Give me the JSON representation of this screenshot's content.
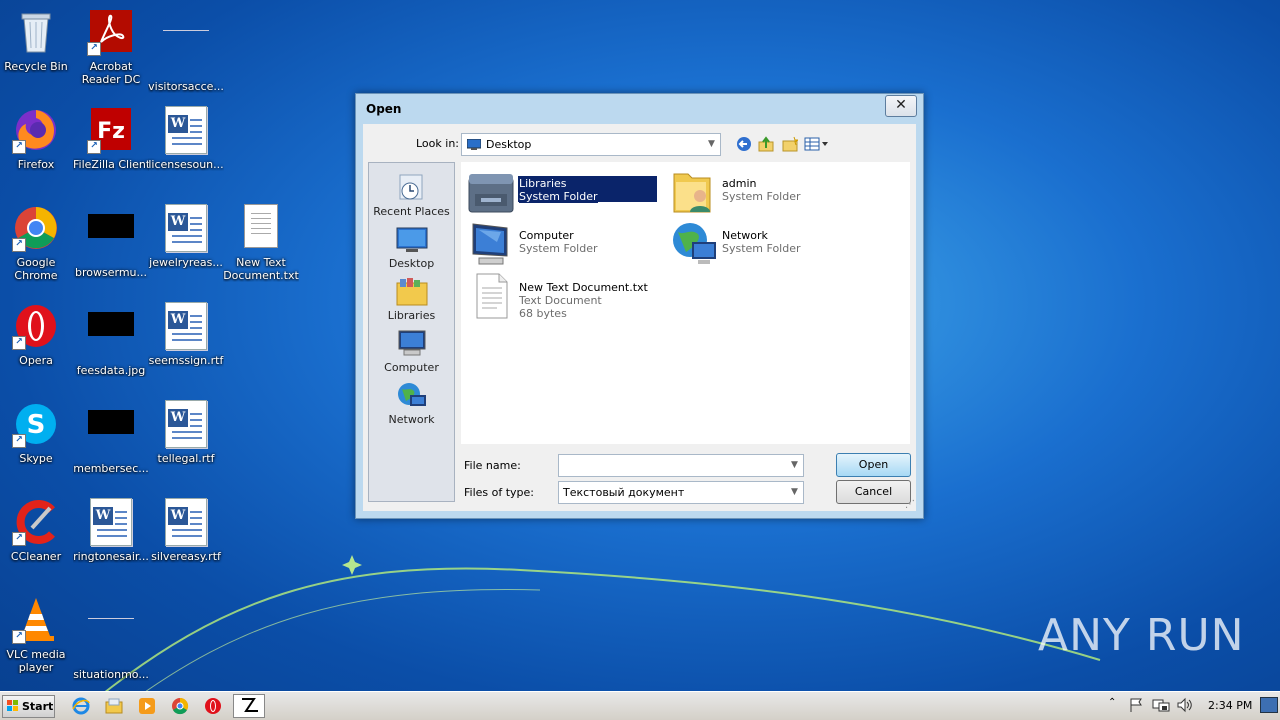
{
  "desktop": {
    "icons": [
      {
        "label": "Recycle Bin"
      },
      {
        "label": "Acrobat Reader DC"
      },
      {
        "label": "visitorsacce..."
      },
      {
        "label": "Firefox"
      },
      {
        "label": "FileZilla Client"
      },
      {
        "label": "licensesoun..."
      },
      {
        "label": "Google Chrome"
      },
      {
        "label": "browsermu..."
      },
      {
        "label": "jewelryreas..."
      },
      {
        "label": "New Text Document.txt"
      },
      {
        "label": "Opera"
      },
      {
        "label": "feesdata.jpg"
      },
      {
        "label": "seemssign.rtf"
      },
      {
        "label": "Skype"
      },
      {
        "label": "membersec..."
      },
      {
        "label": "tellegal.rtf"
      },
      {
        "label": "CCleaner"
      },
      {
        "label": "ringtonesair..."
      },
      {
        "label": "silvereasy.rtf"
      },
      {
        "label": "VLC media player"
      },
      {
        "label": "situationmo..."
      }
    ]
  },
  "dialog": {
    "title": "Open",
    "close_label": "✕",
    "look_in_label": "Look in:",
    "look_in_value": "Desktop",
    "places": [
      {
        "label": "Recent Places",
        "icon": "recent-places-icon"
      },
      {
        "label": "Desktop",
        "icon": "desktop-icon"
      },
      {
        "label": "Libraries",
        "icon": "libraries-icon"
      },
      {
        "label": "Computer",
        "icon": "computer-icon"
      },
      {
        "label": "Network",
        "icon": "network-icon"
      }
    ],
    "files": [
      {
        "name": "Libraries",
        "type": "System Folder",
        "selected": true
      },
      {
        "name": "admin",
        "type": "System Folder"
      },
      {
        "name": "Computer",
        "type": "System Folder"
      },
      {
        "name": "Network",
        "type": "System Folder"
      },
      {
        "name": "New Text Document.txt",
        "type": "Text Document",
        "size": "68 bytes"
      }
    ],
    "file_name_label": "File name:",
    "file_name_value": "",
    "files_of_type_label": "Files of type:",
    "files_of_type_value": "Текстовый документ",
    "open_label": "Open",
    "cancel_label": "Cancel"
  },
  "taskbar": {
    "start_label": "Start",
    "clock": "2:34 PM"
  },
  "watermark": "ANY RUN",
  "colors": {
    "selection": "#0a246a",
    "wallpaper": "#1a6fcf"
  }
}
